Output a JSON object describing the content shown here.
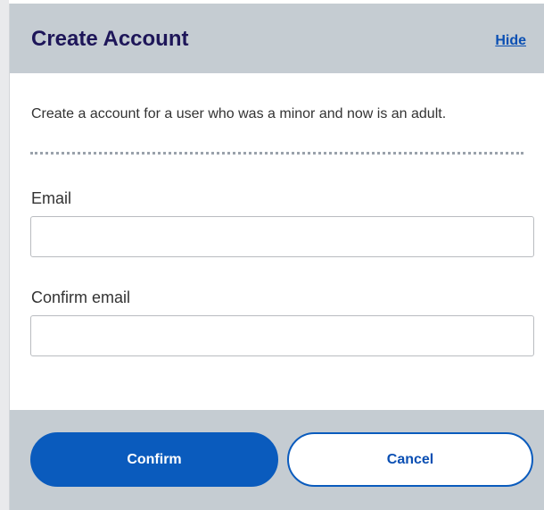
{
  "dialog": {
    "title": "Create Account",
    "hide_label": "Hide",
    "description": "Create a account for a user who was a minor and now is an adult."
  },
  "form": {
    "email": {
      "label": "Email",
      "value": "",
      "placeholder": ""
    },
    "confirm_email": {
      "label": "Confirm email",
      "value": "",
      "placeholder": ""
    }
  },
  "actions": {
    "confirm_label": "Confirm",
    "cancel_label": "Cancel"
  },
  "colors": {
    "header_background": "#c5ccd2",
    "title_text": "#1e1659",
    "primary_button": "#0a5bbd",
    "link_text": "#0a4fb3"
  }
}
